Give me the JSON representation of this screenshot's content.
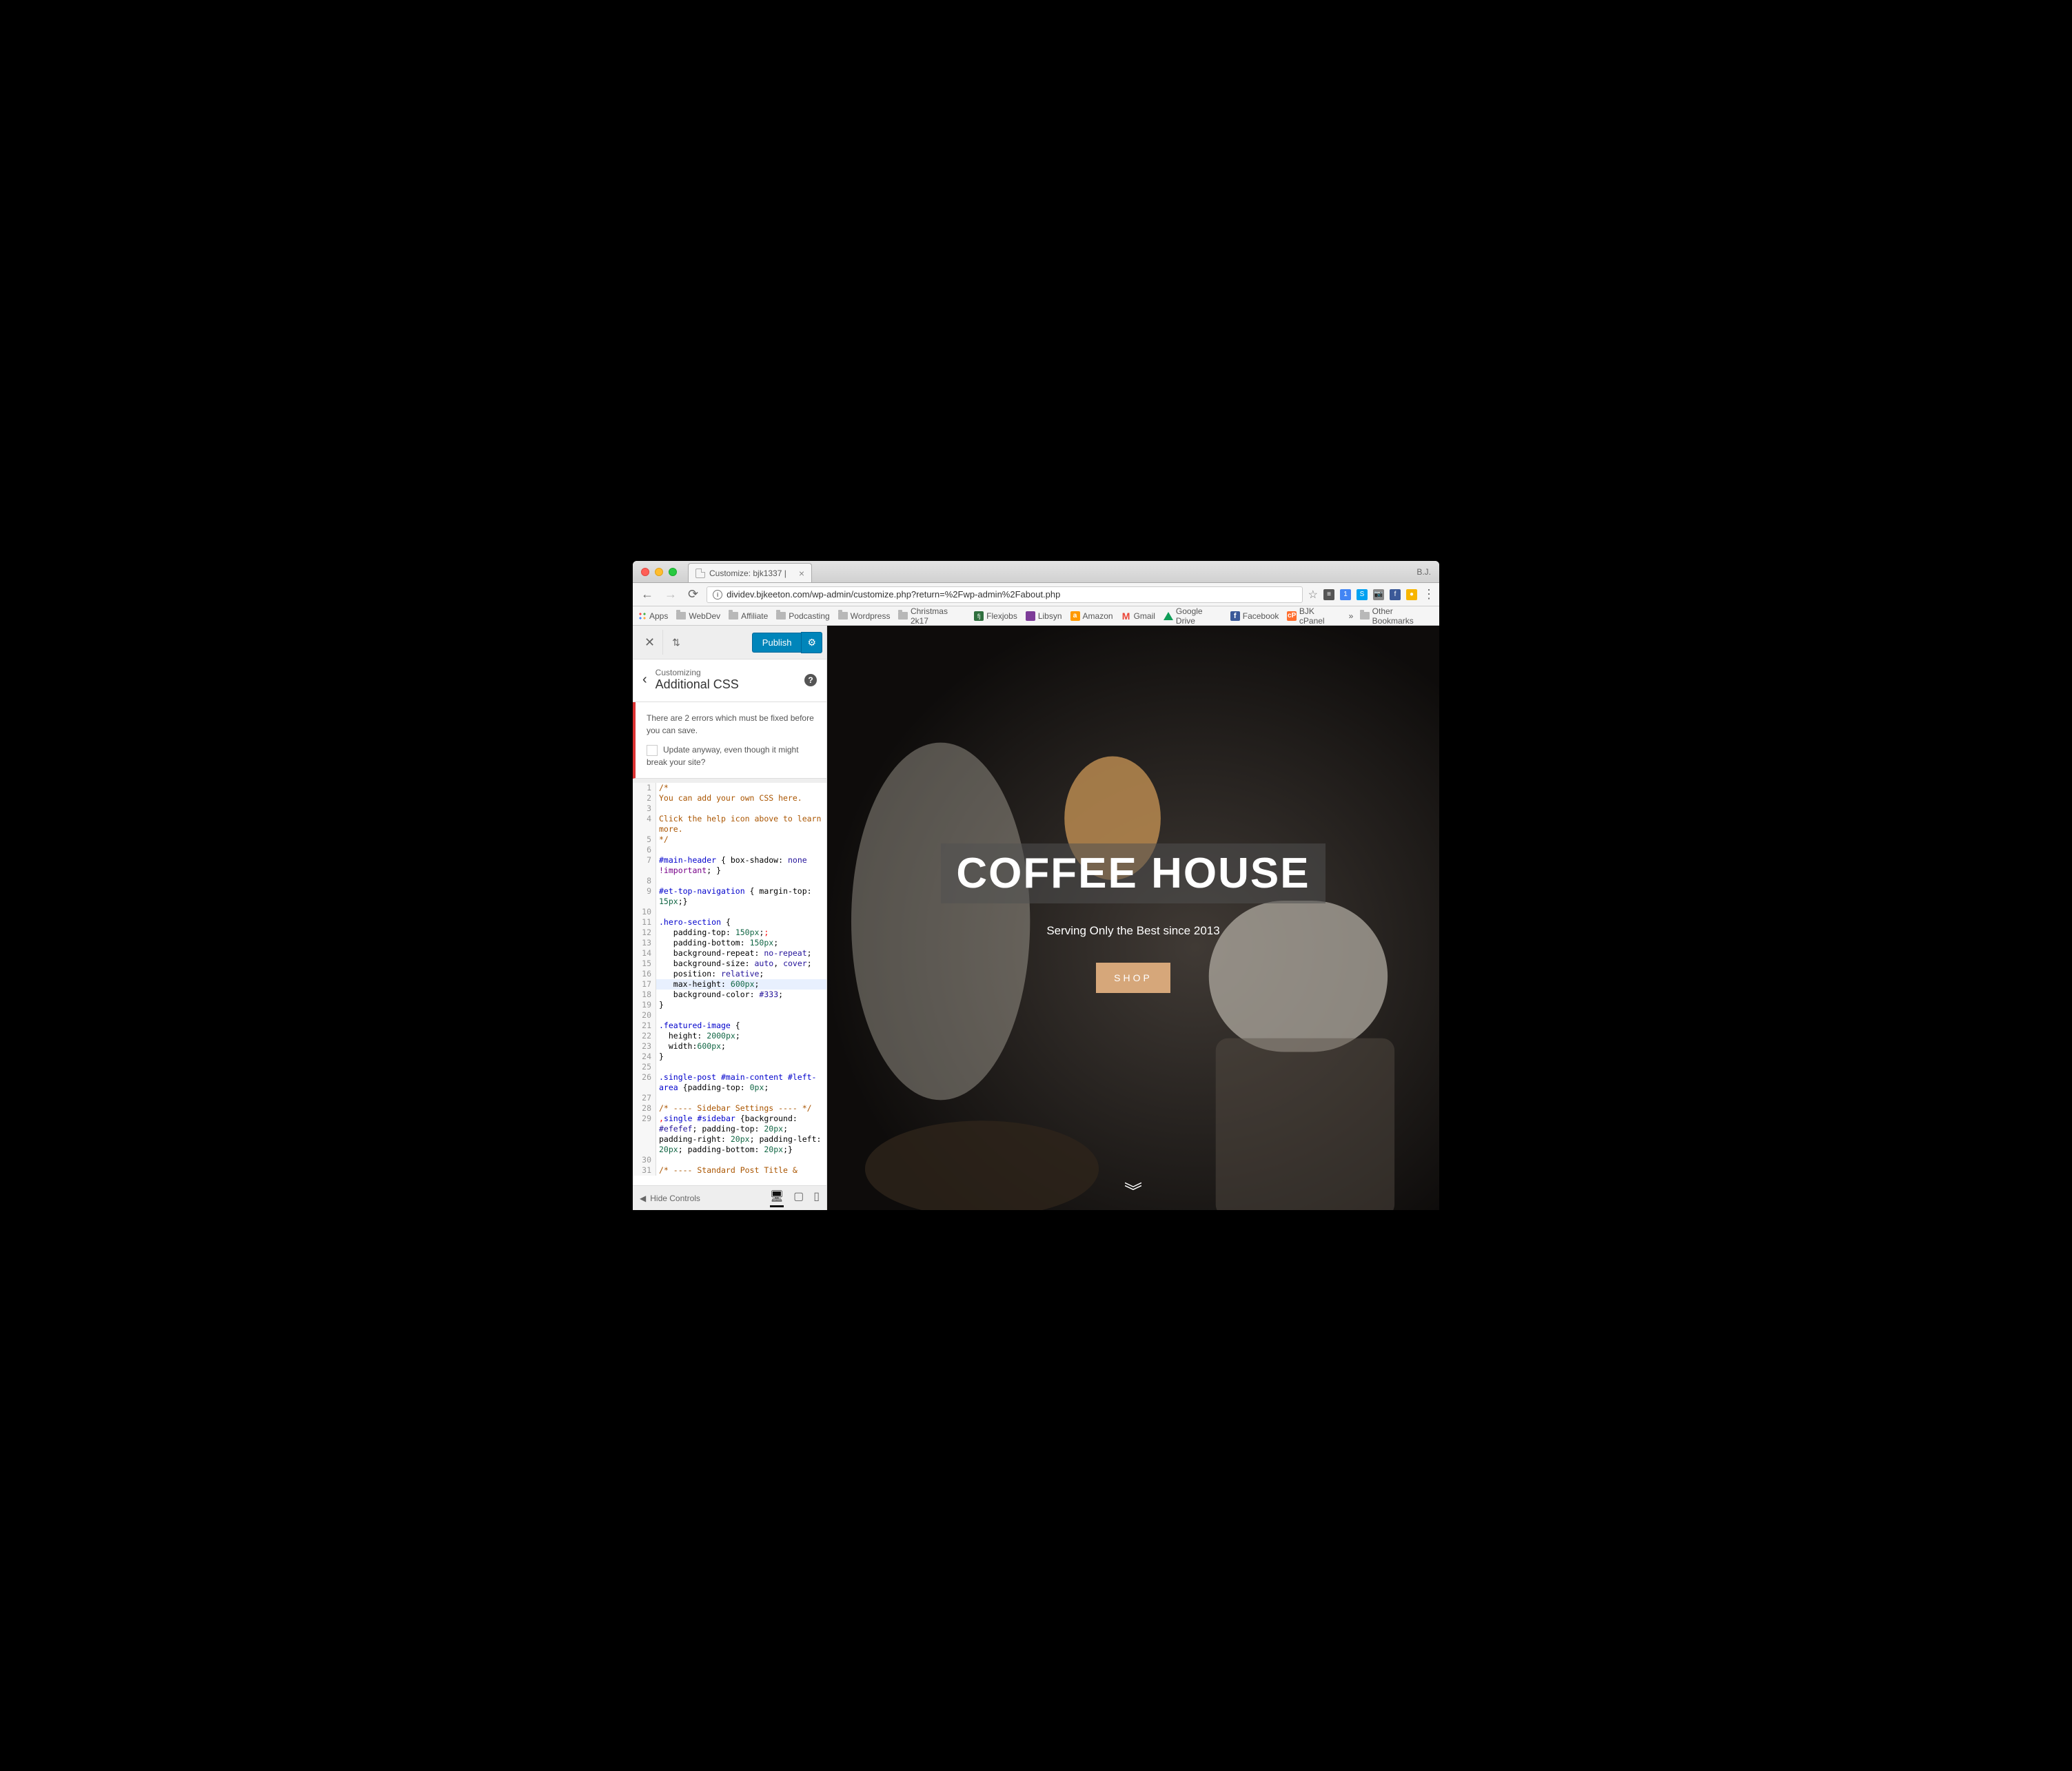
{
  "browser": {
    "tab_title": "Customize: bjk1337 |",
    "profile": "B.J.",
    "url": "dividev.bjkeeton.com/wp-admin/customize.php?return=%2Fwp-admin%2Fabout.php"
  },
  "bookmarks": {
    "apps": "Apps",
    "items": [
      "WebDev",
      "Affiliate",
      "Podcasting",
      "Wordpress",
      "Christmas 2k17",
      "Flexjobs",
      "Libsyn",
      "Amazon",
      "Gmail",
      "Google Drive",
      "Facebook",
      "BJK cPanel"
    ],
    "overflow": "»",
    "other": "Other Bookmarks"
  },
  "customizer": {
    "publish": "Publish",
    "breadcrumb": "Customizing",
    "title": "Additional CSS",
    "error_text": "There are 2 errors which must be fixed before you can save.",
    "update_anyway": "Update anyway, even though it might break your site?",
    "hide_controls": "Hide Controls"
  },
  "code": [
    {
      "n": 1,
      "seg": [
        {
          "c": "cm-comment",
          "t": "/*"
        }
      ]
    },
    {
      "n": 2,
      "seg": [
        {
          "c": "cm-comment",
          "t": "You can add your own CSS here."
        }
      ]
    },
    {
      "n": 3,
      "seg": []
    },
    {
      "n": 4,
      "seg": [
        {
          "c": "cm-comment",
          "t": "Click the help icon above to learn more."
        }
      ]
    },
    {
      "n": 5,
      "seg": [
        {
          "c": "cm-comment",
          "t": "*/"
        }
      ]
    },
    {
      "n": 6,
      "seg": []
    },
    {
      "n": 7,
      "seg": [
        {
          "c": "cm-selector",
          "t": "#main-header"
        },
        {
          "c": "",
          "t": " { "
        },
        {
          "c": "cm-property",
          "t": "box-shadow"
        },
        {
          "c": "",
          "t": ": "
        },
        {
          "c": "cm-atom",
          "t": "none"
        },
        {
          "c": "",
          "t": " "
        },
        {
          "c": "cm-keyword",
          "t": "!important"
        },
        {
          "c": "",
          "t": "; }"
        }
      ]
    },
    {
      "n": 8,
      "seg": []
    },
    {
      "n": 9,
      "seg": [
        {
          "c": "cm-selector",
          "t": "#et-top-navigation"
        },
        {
          "c": "",
          "t": " { "
        },
        {
          "c": "cm-property",
          "t": "margin-top"
        },
        {
          "c": "",
          "t": ": "
        },
        {
          "c": "cm-number",
          "t": "15px"
        },
        {
          "c": "",
          "t": ";}"
        }
      ]
    },
    {
      "n": 10,
      "seg": []
    },
    {
      "n": 11,
      "seg": [
        {
          "c": "cm-selector",
          "t": ".hero-section"
        },
        {
          "c": "",
          "t": " {"
        }
      ]
    },
    {
      "n": 12,
      "err": true,
      "seg": [
        {
          "c": "",
          "t": "   "
        },
        {
          "c": "cm-property",
          "t": "padding-top"
        },
        {
          "c": "",
          "t": ": "
        },
        {
          "c": "cm-number",
          "t": "150px"
        },
        {
          "c": "",
          "t": ";"
        },
        {
          "c": "cm-err",
          "t": ";"
        }
      ]
    },
    {
      "n": 13,
      "seg": [
        {
          "c": "",
          "t": "   "
        },
        {
          "c": "cm-property",
          "t": "padding-bottom"
        },
        {
          "c": "",
          "t": ": "
        },
        {
          "c": "cm-number",
          "t": "150px"
        },
        {
          "c": "",
          "t": ";"
        }
      ]
    },
    {
      "n": 14,
      "seg": [
        {
          "c": "",
          "t": "   "
        },
        {
          "c": "cm-property",
          "t": "background-repeat"
        },
        {
          "c": "",
          "t": ": "
        },
        {
          "c": "cm-atom",
          "t": "no-repeat"
        },
        {
          "c": "",
          "t": ";"
        }
      ]
    },
    {
      "n": 15,
      "seg": [
        {
          "c": "",
          "t": "   "
        },
        {
          "c": "cm-property",
          "t": "background-size"
        },
        {
          "c": "",
          "t": ": "
        },
        {
          "c": "cm-atom",
          "t": "auto"
        },
        {
          "c": "",
          "t": ", "
        },
        {
          "c": "cm-atom",
          "t": "cover"
        },
        {
          "c": "",
          "t": ";"
        }
      ]
    },
    {
      "n": 16,
      "seg": [
        {
          "c": "",
          "t": "   "
        },
        {
          "c": "cm-property",
          "t": "position"
        },
        {
          "c": "",
          "t": ": "
        },
        {
          "c": "cm-atom",
          "t": "relative"
        },
        {
          "c": "",
          "t": ";"
        }
      ]
    },
    {
      "n": 17,
      "active": true,
      "seg": [
        {
          "c": "",
          "t": "   "
        },
        {
          "c": "cm-property",
          "t": "max-height"
        },
        {
          "c": "",
          "t": ": "
        },
        {
          "c": "cm-number",
          "t": "600px"
        },
        {
          "c": "",
          "t": ";"
        }
      ]
    },
    {
      "n": 18,
      "seg": [
        {
          "c": "",
          "t": "   "
        },
        {
          "c": "cm-property",
          "t": "background-color"
        },
        {
          "c": "",
          "t": ": "
        },
        {
          "c": "cm-hex",
          "t": "#333"
        },
        {
          "c": "",
          "t": ";"
        }
      ]
    },
    {
      "n": 19,
      "seg": [
        {
          "c": "",
          "t": "}"
        }
      ]
    },
    {
      "n": 20,
      "seg": []
    },
    {
      "n": 21,
      "seg": [
        {
          "c": "cm-selector",
          "t": ".featured-image"
        },
        {
          "c": "",
          "t": " {"
        }
      ]
    },
    {
      "n": 22,
      "seg": [
        {
          "c": "",
          "t": "  "
        },
        {
          "c": "cm-property",
          "t": "height"
        },
        {
          "c": "",
          "t": ": "
        },
        {
          "c": "cm-number",
          "t": "2000px"
        },
        {
          "c": "",
          "t": ";"
        }
      ]
    },
    {
      "n": 23,
      "seg": [
        {
          "c": "",
          "t": "  "
        },
        {
          "c": "cm-property",
          "t": "width"
        },
        {
          "c": "",
          "t": ":"
        },
        {
          "c": "cm-number",
          "t": "600px"
        },
        {
          "c": "",
          "t": ";"
        }
      ]
    },
    {
      "n": 24,
      "seg": [
        {
          "c": "",
          "t": "}"
        }
      ]
    },
    {
      "n": 25,
      "seg": []
    },
    {
      "n": 26,
      "seg": [
        {
          "c": "cm-selector",
          "t": ".single-post #main-content #left-area"
        },
        {
          "c": "",
          "t": " {"
        },
        {
          "c": "cm-property",
          "t": "padding-top"
        },
        {
          "c": "",
          "t": ": "
        },
        {
          "c": "cm-number",
          "t": "0px"
        },
        {
          "c": "",
          "t": ";"
        }
      ]
    },
    {
      "n": 27,
      "seg": []
    },
    {
      "n": 28,
      "seg": [
        {
          "c": "cm-comment",
          "t": "/* ---- Sidebar Settings ---- */"
        }
      ]
    },
    {
      "n": 29,
      "err": true,
      "seg": [
        {
          "c": "cm-err",
          "t": ","
        },
        {
          "c": "cm-selector",
          "t": "single #sidebar"
        },
        {
          "c": "",
          "t": " {"
        },
        {
          "c": "cm-property",
          "t": "background"
        },
        {
          "c": "",
          "t": ": "
        },
        {
          "c": "cm-hex",
          "t": "#efefef"
        },
        {
          "c": "",
          "t": "; "
        },
        {
          "c": "cm-property",
          "t": "padding-top"
        },
        {
          "c": "",
          "t": ": "
        },
        {
          "c": "cm-number",
          "t": "20px"
        },
        {
          "c": "",
          "t": "; "
        },
        {
          "c": "cm-property",
          "t": "padding-right"
        },
        {
          "c": "",
          "t": ": "
        },
        {
          "c": "cm-number",
          "t": "20px"
        },
        {
          "c": "",
          "t": "; "
        },
        {
          "c": "cm-property",
          "t": "padding-left"
        },
        {
          "c": "",
          "t": ": "
        },
        {
          "c": "cm-number",
          "t": "20px"
        },
        {
          "c": "",
          "t": "; "
        },
        {
          "c": "cm-property",
          "t": "padding-bottom"
        },
        {
          "c": "",
          "t": ": "
        },
        {
          "c": "cm-number",
          "t": "20px"
        },
        {
          "c": "",
          "t": ";}"
        }
      ]
    },
    {
      "n": 30,
      "seg": []
    },
    {
      "n": 31,
      "seg": [
        {
          "c": "cm-comment",
          "t": "/* ---- Standard Post Title & "
        }
      ]
    }
  ],
  "preview": {
    "title": "COFFEE HOUSE",
    "subtitle": "Serving Only the Best since 2013",
    "button": "SHOP"
  }
}
